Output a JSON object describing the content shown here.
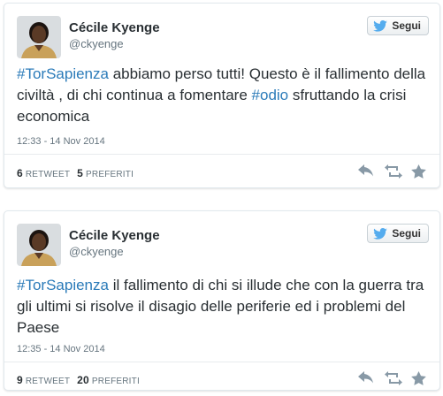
{
  "tweets": [
    {
      "name": "Cécile Kyenge",
      "handle": "@ckyenge",
      "follow_label": "Segui",
      "text_segments": [
        {
          "type": "hashtag",
          "text": "#TorSapienza"
        },
        {
          "type": "text",
          "text": " abbiamo perso tutti! Questo è il fallimento della civiltà , di chi continua a fomentare "
        },
        {
          "type": "hashtag",
          "text": "#odio"
        },
        {
          "type": "text",
          "text": " sfruttando la crisi economica"
        }
      ],
      "date": "12:33 - 14 Nov 2014",
      "retweets_count": "6",
      "retweets_label": "RETWEET",
      "favorites_count": "5",
      "favorites_label": "PREFERITI"
    },
    {
      "name": "Cécile Kyenge",
      "handle": "@ckyenge",
      "follow_label": "Segui",
      "text_segments": [
        {
          "type": "hashtag",
          "text": "#TorSapienza"
        },
        {
          "type": "text",
          "text": " il fallimento di chi si illude che con la guerra tra gli ultimi si risolve il disagio delle periferie ed i problemi del Paese"
        }
      ],
      "date": "12:35 - 14 Nov 2014",
      "retweets_count": "9",
      "retweets_label": "RETWEET",
      "favorites_count": "20",
      "favorites_label": "PREFERITI"
    }
  ],
  "colors": {
    "hashtag": "#2b7bb9",
    "twitter_bird": "#55acee",
    "action_icon": "#8899a6"
  },
  "icons": {
    "follow": "twitter-bird-icon",
    "reply": "reply-icon",
    "retweet": "retweet-icon",
    "favorite": "star-icon"
  }
}
